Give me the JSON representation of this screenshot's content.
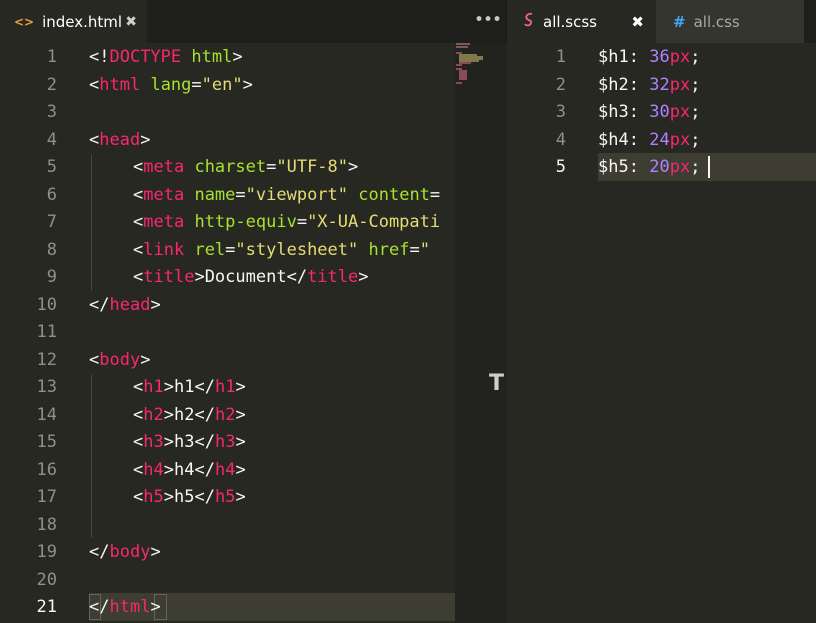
{
  "left_tabs": [
    {
      "icon": "<>",
      "label": "index.html",
      "close": "✖"
    }
  ],
  "more_button": "•••",
  "right_tabs": [
    {
      "icon": "S",
      "label": "all.scss",
      "close": "✖"
    },
    {
      "icon": "#",
      "label": "all.css"
    }
  ],
  "left_editor": {
    "line_numbers": [
      "1",
      "2",
      "3",
      "4",
      "5",
      "6",
      "7",
      "8",
      "9",
      "10",
      "11",
      "12",
      "13",
      "14",
      "15",
      "16",
      "17",
      "18",
      "19",
      "20",
      "21"
    ],
    "active_line": "21"
  },
  "right_editor": {
    "line_numbers": [
      "1",
      "2",
      "3",
      "4",
      "5"
    ],
    "active_line": "5",
    "lines": [
      {
        "var": "$h1",
        "colon": ":",
        "num": "36",
        "unit": "px",
        "semi": ";"
      },
      {
        "var": "$h2",
        "colon": ":",
        "num": "32",
        "unit": "px",
        "semi": ";"
      },
      {
        "var": "$h3",
        "colon": ":",
        "num": "30",
        "unit": "px",
        "semi": ";"
      },
      {
        "var": "$h4",
        "colon": ":",
        "num": "24",
        "unit": "px",
        "semi": ";"
      },
      {
        "var": "$h5",
        "colon": ":",
        "num": "20",
        "unit": "px",
        "semi": ";"
      }
    ]
  },
  "colors": {
    "background": "#272822",
    "tag": "#f92672",
    "attribute": "#a6e22e",
    "string": "#e6db74",
    "number": "#ae81ff"
  },
  "code": {
    "l1_a": "<!",
    "l1_b": "DOCTYPE",
    "l1_c": "html",
    "l1_d": ">",
    "lt": "<",
    "gt": ">",
    "lts": "</",
    "eq": "=",
    "html": "html",
    "lang": "lang",
    "en": "\"en\"",
    "head": "head",
    "meta": "meta",
    "link": "link",
    "title": "title",
    "body": "body",
    "charset": "charset",
    "utf8": "\"UTF-8\"",
    "name": "name",
    "viewport": "\"viewport\"",
    "content": "content",
    "http_equiv": "http-equiv",
    "xua": "\"X-UA-Compati",
    "rel": "rel",
    "stylesheet": "\"stylesheet\"",
    "href": "href",
    "href_val": "\"",
    "document": "Document",
    "h1": "h1",
    "h2": "h2",
    "h3": "h3",
    "h4": "h4",
    "h5": "h5"
  },
  "scroll_marker": "T"
}
